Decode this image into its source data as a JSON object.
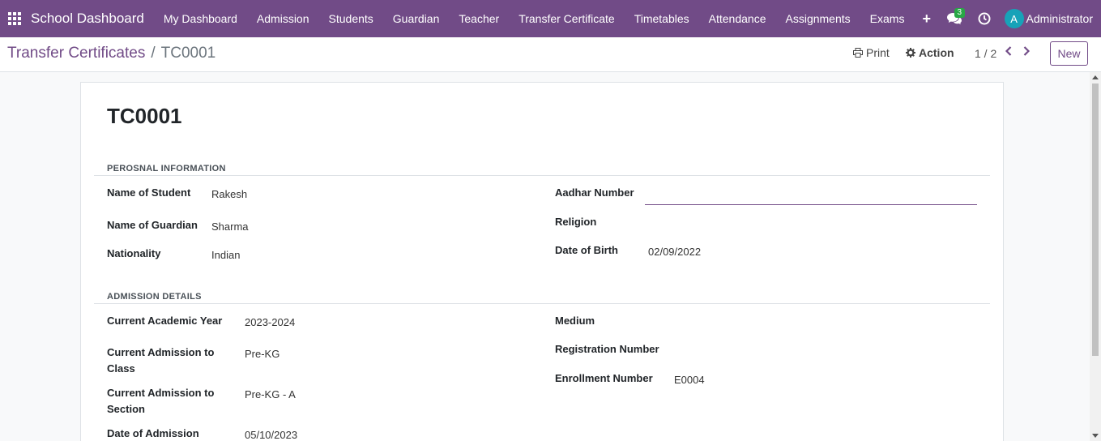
{
  "topbar": {
    "brand": "School Dashboard",
    "menu": [
      "My Dashboard",
      "Admission",
      "Students",
      "Guardian",
      "Teacher",
      "Transfer Certificate",
      "Timetables",
      "Attendance",
      "Assignments",
      "Exams"
    ],
    "plus": "+",
    "chat_count": "3",
    "avatar_letter": "A",
    "user": "Administrator"
  },
  "control": {
    "breadcrumb_parent": "Transfer Certificates",
    "breadcrumb_sep": "/",
    "breadcrumb_current": "TC0001",
    "print_label": "Print",
    "action_label": "Action",
    "pager": "1 / 2",
    "new_label": "New"
  },
  "form": {
    "title": "TC0001",
    "personal": {
      "heading": "PEROSNAL INFORMATION",
      "student_label": "Name of Student",
      "student_value": "Rakesh",
      "guardian_label": "Name of Guardian",
      "guardian_value": "Sharma",
      "nationality_label": "Nationality",
      "nationality_value": "Indian",
      "aadhar_label": "Aadhar Number",
      "aadhar_value": "",
      "religion_label": "Religion",
      "religion_value": "",
      "dob_label": "Date of Birth",
      "dob_value": "02/09/2022"
    },
    "admission": {
      "heading": "ADMISSION DETAILS",
      "year_label": "Current Academic Year",
      "year_value": "2023-2024",
      "class_label_1": "Current Admission to",
      "class_label_2": "Class",
      "class_value": "Pre-KG",
      "section_label_1": "Current Admission to",
      "section_label_2": "Section",
      "section_value": "Pre-KG - A",
      "date_label": "Date of Admission",
      "date_value": "05/10/2023",
      "medium_label": "Medium",
      "medium_value": "",
      "reg_label": "Registration Number",
      "reg_value": "",
      "enroll_label": "Enrollment Number",
      "enroll_value": "E0004"
    }
  },
  "colors": {
    "brand": "#714b87",
    "badge": "#28a745",
    "avatar": "#17a2b8"
  }
}
